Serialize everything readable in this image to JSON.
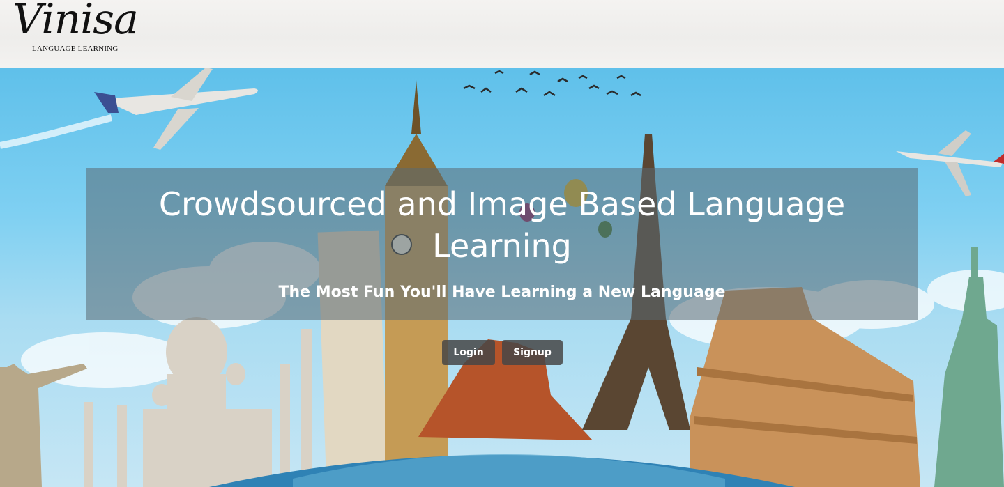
{
  "brand": {
    "name": "Vinisa",
    "tagline": "LANGUAGE LEARNING"
  },
  "hero": {
    "title": "Crowdsourced and Image Based Language Learning",
    "subtitle": "The Most Fun You'll Have Learning a New Language",
    "login_label": "Login",
    "signup_label": "Signup"
  },
  "colors": {
    "sky_top": "#5fc0ea",
    "banner_overlay": "rgba(90,105,115,0.55)",
    "button_bg": "rgba(70,70,70,0.85)",
    "text": "#ffffff"
  }
}
